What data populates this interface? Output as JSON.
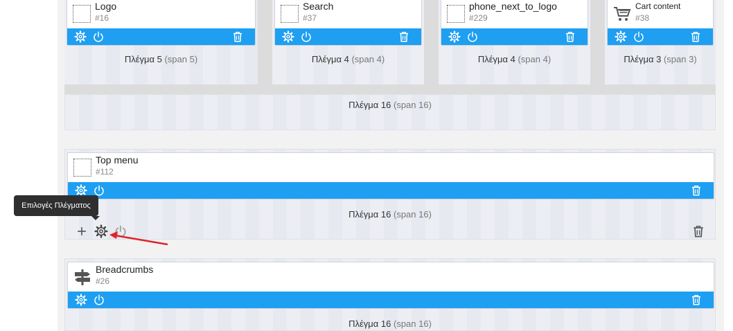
{
  "colors": {
    "accent": "#1e9ff2",
    "annotation_arrow": "#e0242a",
    "tooltip_bg": "#2f2f2f"
  },
  "row1": {
    "columns": [
      {
        "label": "Πλέγμα 5",
        "span": "(span 5)",
        "module": {
          "name": "Logo",
          "id": "#16",
          "icon": "placeholder-icon"
        }
      },
      {
        "label": "Πλέγμα 4",
        "span": "(span 4)",
        "module": {
          "name": "Search",
          "id": "#37",
          "icon": "placeholder-icon"
        }
      },
      {
        "label": "Πλέγμα 4",
        "span": "(span 4)",
        "module": {
          "name": "phone_next_to_logo",
          "id": "#229",
          "icon": "placeholder-icon"
        }
      },
      {
        "label": "Πλέγμα 3",
        "span": "(span 3)",
        "module": {
          "name": "Cart content",
          "id": "#38",
          "icon": "cart-icon"
        }
      }
    ],
    "footer": {
      "label": "Πλέγμα 16",
      "span": "(span 16)"
    }
  },
  "row2": {
    "module": {
      "name": "Top menu",
      "id": "#112",
      "icon": "placeholder-icon"
    },
    "label": "Πλέγμα 16",
    "span": "(span 16)",
    "tooltip": "Επιλογές Πλέγματος"
  },
  "row3": {
    "module": {
      "name": "Breadcrumbs",
      "id": "#26",
      "icon": "signpost-icon"
    },
    "label": "Πλέγμα 16",
    "span": "(span 16)"
  }
}
